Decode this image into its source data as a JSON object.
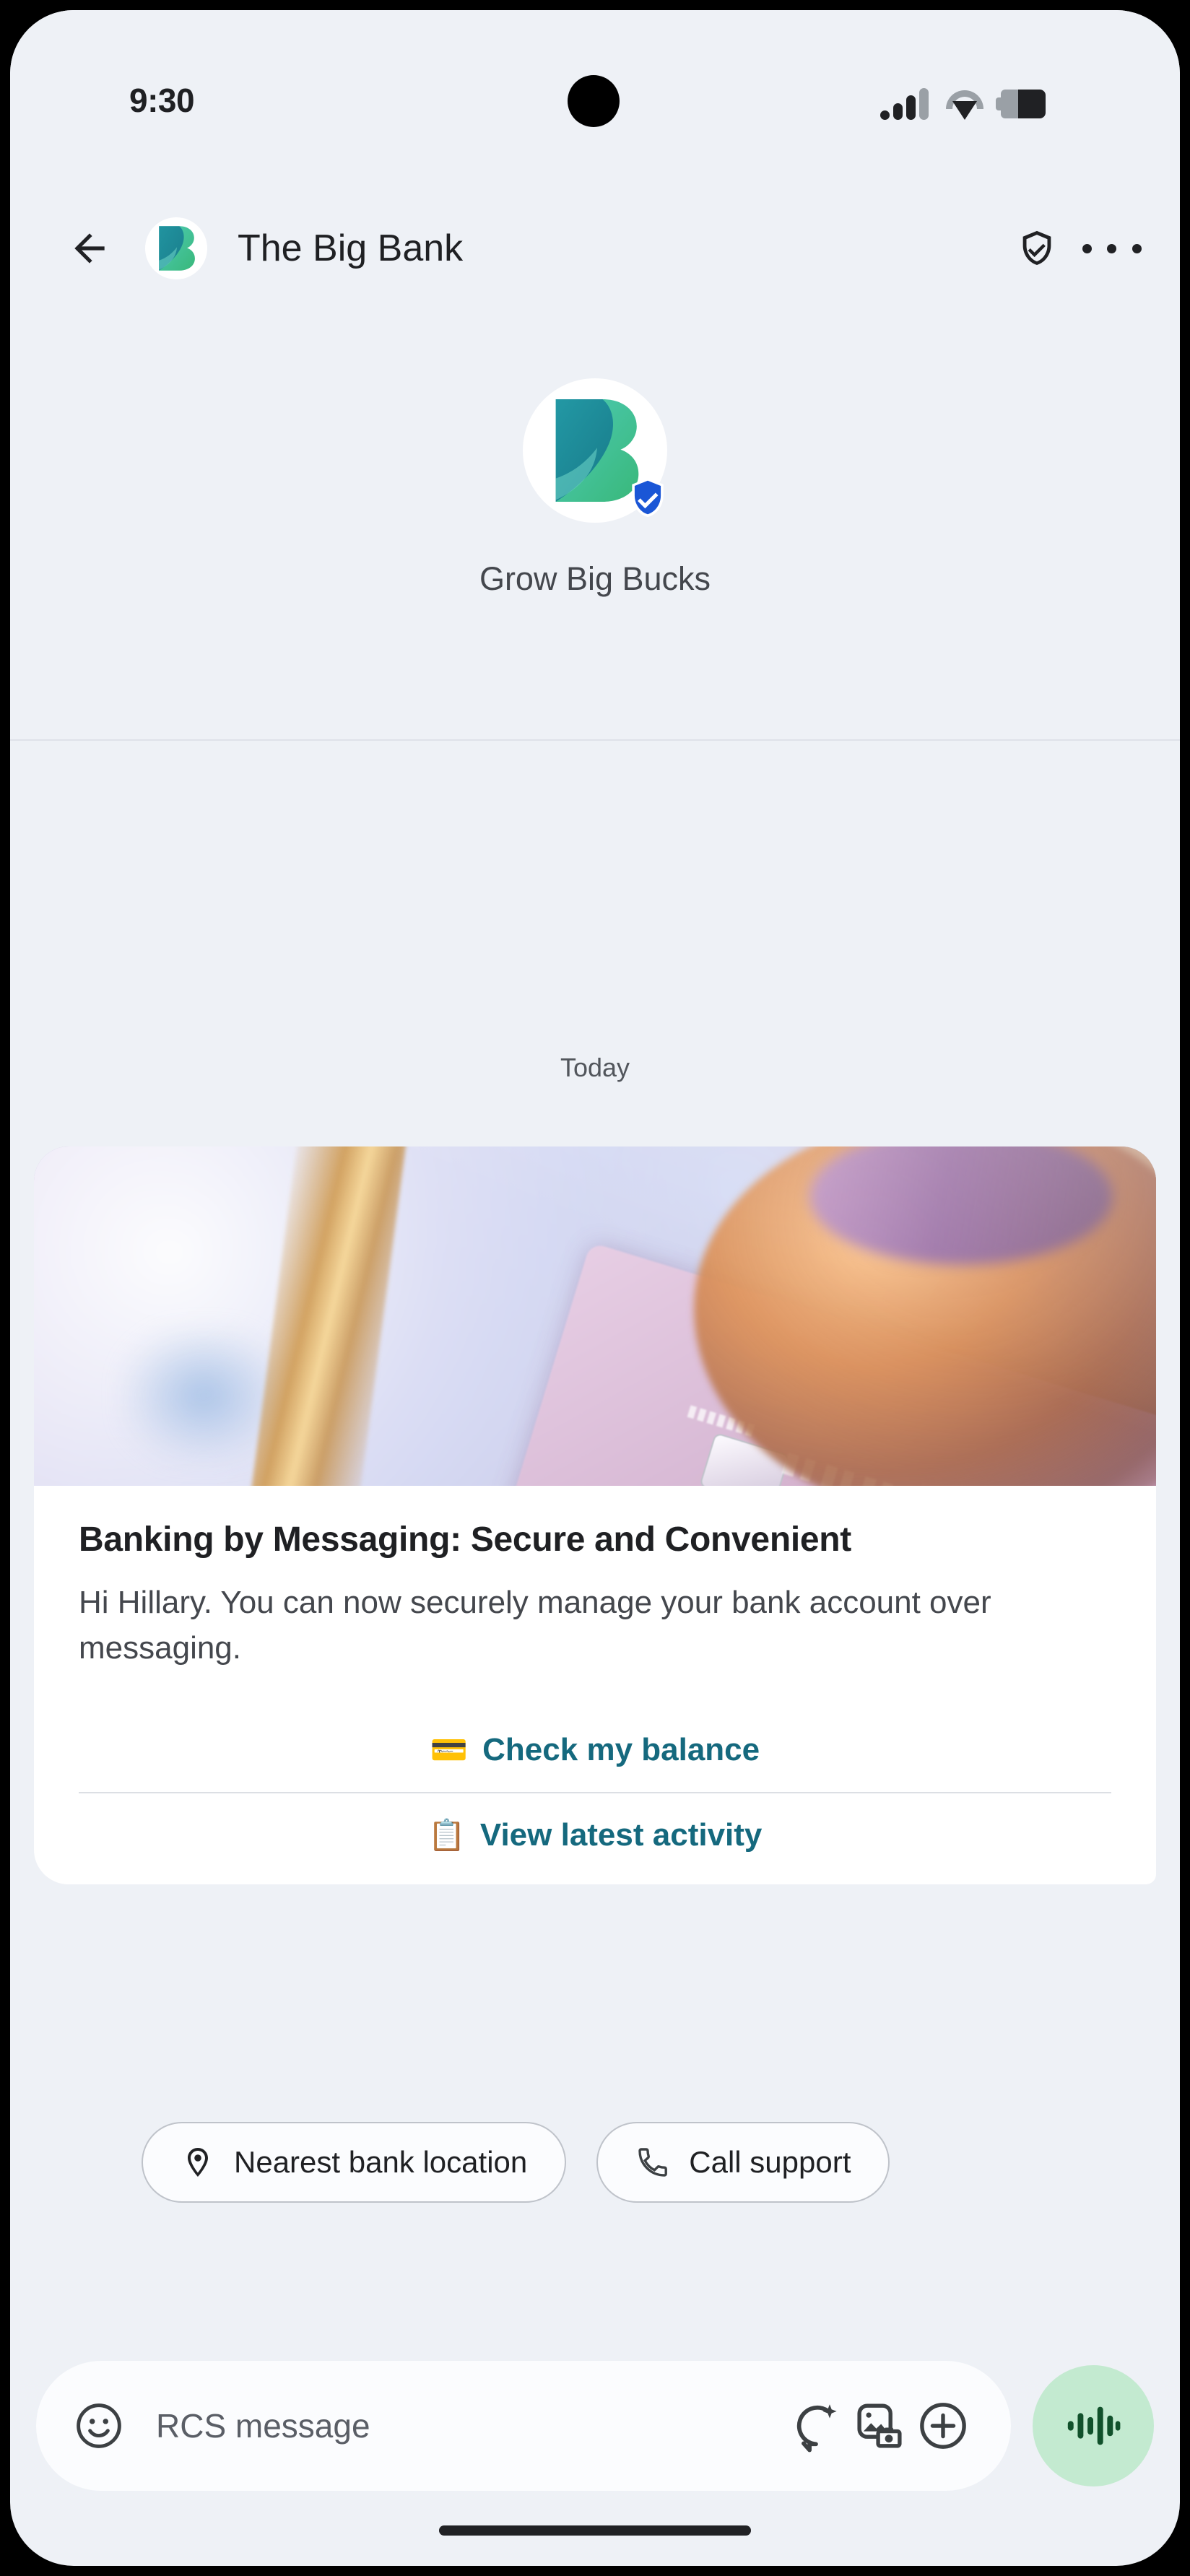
{
  "status_bar": {
    "time": "9:30",
    "icons": [
      "signal-icon",
      "wifi-icon",
      "battery-icon"
    ]
  },
  "app_bar": {
    "back_icon": "back-arrow-icon",
    "title": "The Big Bank",
    "avatar_icon": "big-bank-logo",
    "verified_icon": "shield-check-icon",
    "overflow_icon": "more-vert-icon"
  },
  "brand_intro": {
    "avatar_icon": "big-bank-logo",
    "verified_badge_icon": "verified-shield-badge",
    "tagline": "Grow Big Bucks"
  },
  "thread": {
    "day_divider": "Today",
    "rich_card": {
      "media_alt": "hand-holding-debit-card-photo",
      "title": "Banking by Messaging: Secure and Convenient",
      "description": "Hi Hillary. You can now securely manage your bank account over messaging.",
      "actions": [
        {
          "emoji": "💳",
          "label": "Check my balance",
          "icon_name": "credit-card-emoji"
        },
        {
          "emoji": "📋",
          "label": "View latest activity",
          "icon_name": "clipboard-emoji"
        }
      ],
      "link_color": "#15697e"
    }
  },
  "suggestion_chips": [
    {
      "label": "Nearest bank location",
      "icon_name": "location-pin-icon"
    },
    {
      "label": "Call support",
      "icon_name": "phone-icon"
    }
  ],
  "composer": {
    "emoji_icon": "emoji-smiley-icon",
    "placeholder": "RCS message",
    "actions": [
      {
        "icon_name": "magic-compose-icon"
      },
      {
        "icon_name": "gallery-camera-icon"
      },
      {
        "icon_name": "plus-circle-icon"
      }
    ],
    "voice_icon": "voice-waveform-icon",
    "voice_button_color": "#c3ead0"
  },
  "colors": {
    "screen_background": "#eef1f6",
    "card_surface": "#ffffff",
    "accent_link": "#15697e",
    "brand_teal": "#3ec6b4",
    "brand_green": "#3fba7a",
    "verified_blue": "#1a56d6",
    "voice_green": "#c3ead0"
  }
}
